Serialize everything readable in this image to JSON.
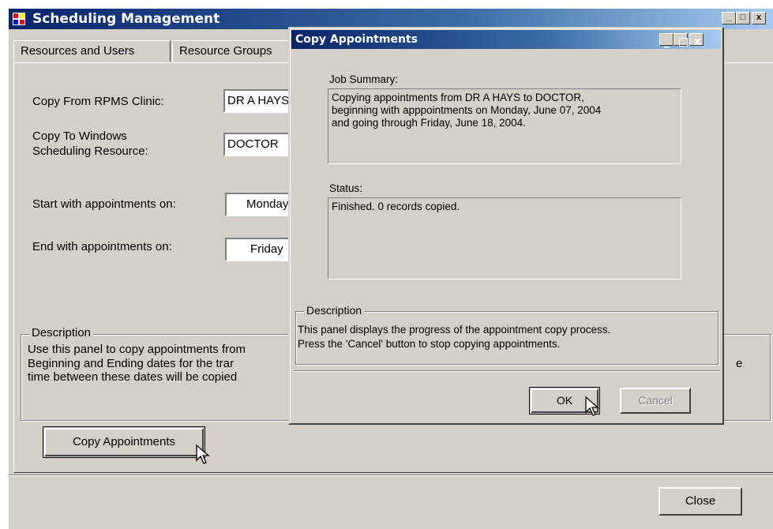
{
  "main_window": {
    "title": "Scheduling Management",
    "caption_buttons": [
      "_",
      "□",
      "x"
    ],
    "tabs": [
      "Resources and Users",
      "Resource Groups"
    ],
    "form": {
      "copy_from_label": "Copy From RPMS Clinic:",
      "copy_from_value": "DR A HAYS",
      "copy_to_label_line1": "Copy To Windows",
      "copy_to_label_line2": "Scheduling Resource:",
      "copy_to_value": "DOCTOR",
      "start_label": "Start with appointments on:",
      "start_value": "Monday",
      "end_label": "End with appointments on:",
      "end_value": "Friday"
    },
    "description": {
      "title": "Description",
      "line1": "Use this panel to copy appointments from",
      "line2": "Beginning and Ending dates for the trar",
      "line3": "time between these dates will be copied",
      "trailing": "e"
    },
    "copy_button": "Copy Appointments",
    "close_button": "Close"
  },
  "dialog": {
    "title": "Copy Appointments",
    "caption_buttons": [
      "_",
      "□",
      "x"
    ],
    "job_summary_label": "Job Summary:",
    "job_summary_lines": [
      "Copying appointments from DR A HAYS to DOCTOR,",
      "beginning with apppointments on Monday, June 07, 2004",
      "and going through Friday, June 18, 2004."
    ],
    "status_label": "Status:",
    "status_text": "Finished.  0 records copied.",
    "description_title": "Description",
    "description_line1": "This panel displays the progress of the appointment copy process.",
    "description_line2": "Press the 'Cancel' button to stop copying appointments.",
    "ok_button": "OK",
    "cancel_button": "Cancel"
  }
}
